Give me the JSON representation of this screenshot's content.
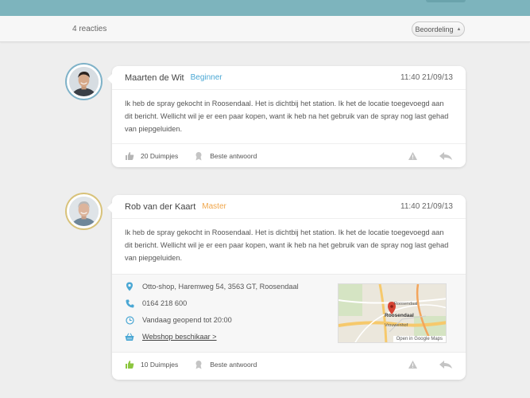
{
  "header": {
    "reactions_count": "4 reacties",
    "sort_label": "Beoordeling"
  },
  "comments": [
    {
      "author": "Maarten de Wit",
      "rank": "Beginner",
      "time": "11:40 21/09/13",
      "text": "Ik heb de spray gekocht in Roosendaal. Het is dichtbij het station. Ik het de locatie toegevoegd aan dit bericht. Wellicht wil je er een paar kopen, want ik heb na het gebruik van de spray nog last gehad van piepgeluiden.",
      "likes": "20 Duimpjes",
      "best_answer": "Beste antwoord"
    },
    {
      "author": "Rob van der Kaart",
      "rank": "Master",
      "time": "11:40 21/09/13",
      "text": "Ik heb de spray gekocht in Roosendaal. Het is dichtbij het station. Ik het de locatie toegevoegd aan dit bericht. Wellicht wil je er een paar kopen, want ik heb na het gebruik van de spray nog last gehad van piepgeluiden.",
      "location": {
        "address": "Otto-shop, Haremweg 54, 3563 GT, Roosendaal",
        "phone": "0164 218 600",
        "hours": "Vandaag geopend tot 20:00",
        "webshop": "Webshop beschikaar >",
        "map_link": "Open in Google Maps",
        "map_labels": [
          "Roosendaal",
          "Vrouwenhof",
          "Roosendaal"
        ]
      },
      "likes": "10 Duimpjes",
      "best_answer": "Beste antwoord"
    }
  ],
  "colors": {
    "topbar": "#7db4bd",
    "beginner": "#4aa7d4",
    "master": "#f0a64a",
    "info_icon": "#4aa7d4",
    "like_active": "#8cc63f"
  },
  "icons": [
    "thumbs-up-icon",
    "ribbon-icon",
    "warning-icon",
    "reply-icon",
    "location-pin-icon",
    "phone-icon",
    "clock-icon",
    "basket-icon"
  ]
}
